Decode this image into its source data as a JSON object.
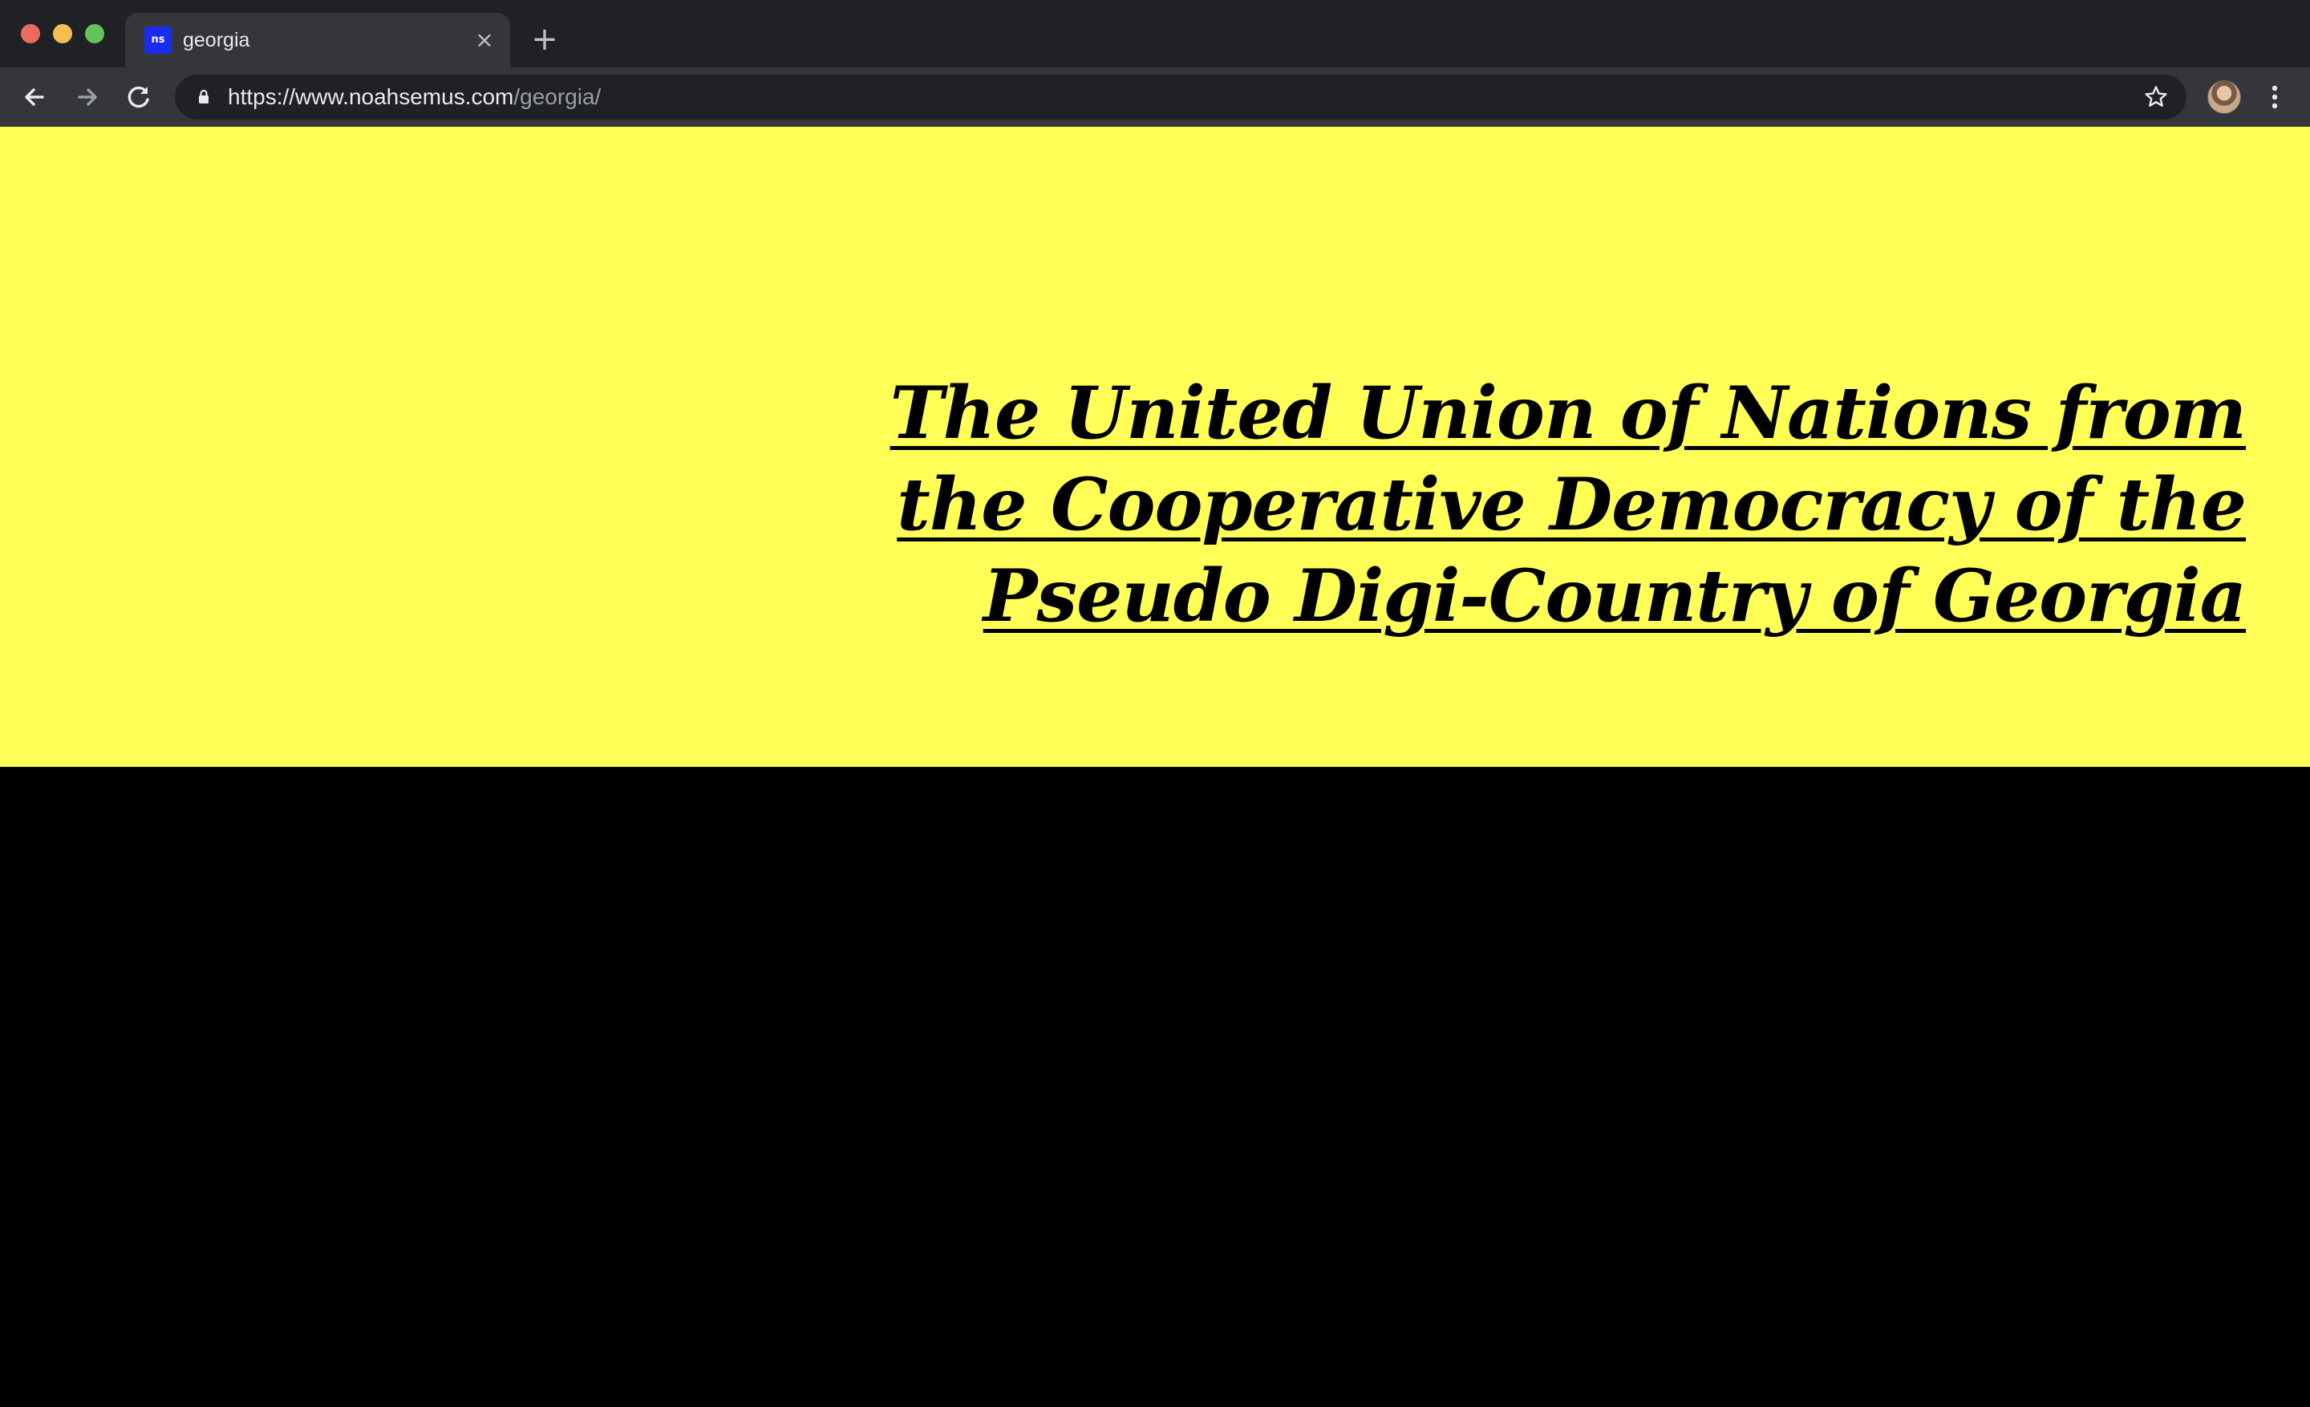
{
  "browser": {
    "tab": {
      "favicon_text": "ns",
      "title": "georgia",
      "close_glyph": "×"
    },
    "new_tab_glyph": "+",
    "address_bar": {
      "url_host": "https://www.noahsemus.com",
      "url_path": "/georgia/"
    },
    "icons": {
      "back": "arrow-left-icon",
      "forward": "arrow-right-icon",
      "reload": "reload-icon",
      "lock": "lock-icon",
      "bookmark": "star-icon",
      "menu": "kebab-menu-icon"
    }
  },
  "page": {
    "title": "The United Union of Nations from the Cooperative Democracy of the Pseudo Digi-Country of Georgia",
    "colors": {
      "hero_background": "#ffff57",
      "lower_background": "#000000",
      "title_color": "#000000"
    }
  }
}
